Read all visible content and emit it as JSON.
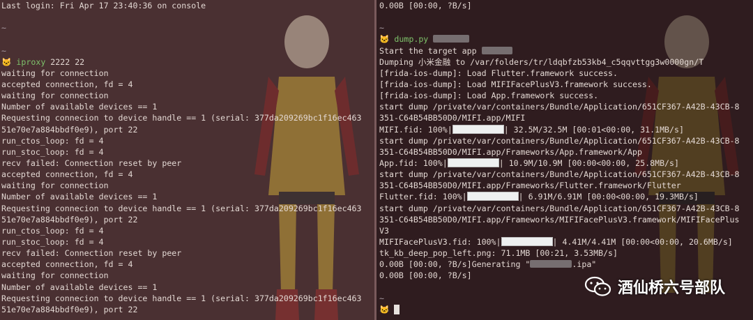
{
  "left": {
    "lines": [
      {
        "t": "Last login: Fri Apr 17 23:40:36 on console"
      },
      {
        "t": ""
      },
      {
        "t": "~",
        "cls": "tilde"
      },
      {
        "t": ""
      },
      {
        "t": "~",
        "cls": "tilde"
      },
      {
        "prompt": true,
        "cmd": "iproxy",
        "args": " 2222 22"
      },
      {
        "t": "waiting for connection"
      },
      {
        "t": "accepted connection, fd = 4"
      },
      {
        "t": "waiting for connection"
      },
      {
        "t": "Number of available devices == 1"
      },
      {
        "t": "Requesting connecion to device handle == 1 (serial: 377da209269bc1f16ec463"
      },
      {
        "t": "51e70e7a884bbdf0e9), port 22"
      },
      {
        "t": "run_ctos_loop: fd = 4"
      },
      {
        "t": "run_stoc_loop: fd = 4"
      },
      {
        "t": "recv failed: Connection reset by peer"
      },
      {
        "t": "accepted connection, fd = 4"
      },
      {
        "t": "waiting for connection"
      },
      {
        "t": "Number of available devices == 1"
      },
      {
        "t": "Requesting connecion to device handle == 1 (serial: 377da209269bc1f16ec463"
      },
      {
        "t": "51e70e7a884bbdf0e9), port 22"
      },
      {
        "t": "run_ctos_loop: fd = 4"
      },
      {
        "t": "run_stoc_loop: fd = 4"
      },
      {
        "t": "recv failed: Connection reset by peer"
      },
      {
        "t": "accepted connection, fd = 4"
      },
      {
        "t": "waiting for connection"
      },
      {
        "t": "Number of available devices == 1"
      },
      {
        "t": "Requesting connecion to device handle == 1 (serial: 377da209269bc1f16ec463"
      },
      {
        "t": "51e70e7a884bbdf0e9), port 22"
      }
    ]
  },
  "right": {
    "lines": [
      {
        "t": "0.00B [00:00, ?B/s]"
      },
      {
        "t": ""
      },
      {
        "t": "~",
        "cls": "tilde"
      },
      {
        "prompt": true,
        "cmd": "dump.py",
        "blur": [
          52
        ]
      },
      {
        "t": "Start the target app ",
        "blur": [
          44
        ]
      },
      {
        "t": "Dumping 小米金融 to /var/folders/tr/ldqbfzb53kb4_c5qqvttgg3w0000gn/T"
      },
      {
        "t": "[frida-ios-dump]: Load Flutter.framework success."
      },
      {
        "t": "[frida-ios-dump]: Load MIFIFacePlusV3.framework success."
      },
      {
        "t": "[frida-ios-dump]: Load App.framework success."
      },
      {
        "t": "start dump /private/var/containers/Bundle/Application/651CF367-A42B-43CB-8"
      },
      {
        "t": "351-C64B54BB50D0/MIFI.app/MIFI"
      },
      {
        "pre": "MIFI.fid: 100%|",
        "bar": true,
        "post": "| 32.5M/32.5M [00:01<00:00, 31.1MB/s]"
      },
      {
        "t": "start dump /private/var/containers/Bundle/Application/651CF367-A42B-43CB-8"
      },
      {
        "t": "351-C64B54BB50D0/MIFI.app/Frameworks/App.framework/App"
      },
      {
        "pre": "App.fid: 100%|",
        "bar": true,
        "post": "| 10.9M/10.9M [00:00<00:00, 25.8MB/s]"
      },
      {
        "t": "start dump /private/var/containers/Bundle/Application/651CF367-A42B-43CB-8"
      },
      {
        "t": "351-C64B54BB50D0/MIFI.app/Frameworks/Flutter.framework/Flutter"
      },
      {
        "pre": "Flutter.fid: 100%|",
        "bar": true,
        "post": "| 6.91M/6.91M [00:00<00:00, 19.3MB/s]"
      },
      {
        "t": "start dump /private/var/containers/Bundle/Application/651CF367-A42B-43CB-8"
      },
      {
        "t": "351-C64B54BB50D0/MIFI.app/Frameworks/MIFIFacePlusV3.framework/MIFIFacePlus"
      },
      {
        "t": "V3"
      },
      {
        "pre": "MIFIFacePlusV3.fid: 100%|",
        "bar": true,
        "post": "| 4.41M/4.41M [00:00<00:00, 20.6MB/s]"
      },
      {
        "t": "tk_kb_deep_pop_left.png: 71.1MB [00:21, 3.53MB/s]"
      },
      {
        "t": "0.00B [00:00, ?B/s]Generating \"",
        "blur": [
          60
        ],
        "after": ".ipa\""
      },
      {
        "t": "0.00B [00:00, ?B/s]"
      },
      {
        "t": ""
      },
      {
        "t": "~",
        "cls": "tilde"
      },
      {
        "prompt": true,
        "cursor": true
      }
    ]
  },
  "watermark": {
    "text": "酒仙桥六号部队",
    "icon": "wechat-icon"
  },
  "colors": {
    "left_bg": "#4a3032",
    "right_bg": "#2f1c1f",
    "text": "#e3d8d3",
    "command": "#7ec36b",
    "tilde": "#a79aa2",
    "prompt_icon": "#f1b43a"
  }
}
